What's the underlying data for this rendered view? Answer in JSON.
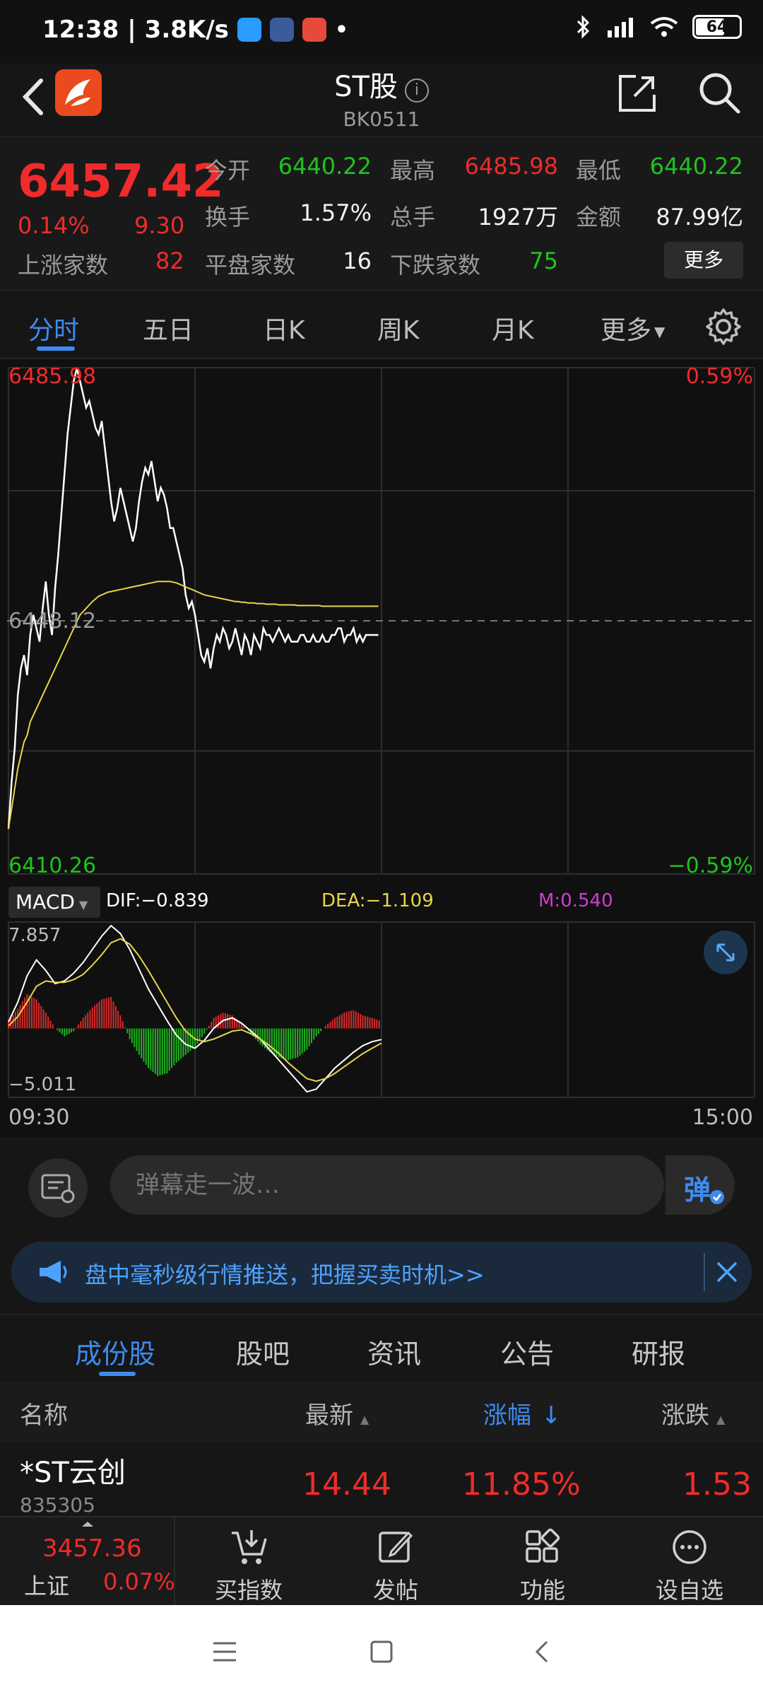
{
  "status_bar": {
    "time": "12:38",
    "net_speed": "3.8K/s",
    "battery": "64"
  },
  "header": {
    "title": "ST股",
    "code": "BK0511"
  },
  "quote": {
    "price": "6457.42",
    "pct": "0.14%",
    "change": "9.30",
    "up_count_label": "上涨家数",
    "up_count": "82",
    "open_label": "今开",
    "open": "6440.22",
    "high_label": "最高",
    "high": "6485.98",
    "low_label": "最低",
    "low": "6440.22",
    "turnover_label": "换手",
    "turnover": "1.57%",
    "volume_label": "总手",
    "volume": "1927万",
    "amount_label": "金额",
    "amount": "87.99亿",
    "flat_label": "平盘家数",
    "flat_count": "16",
    "down_label": "下跌家数",
    "down_count": "75",
    "more": "更多"
  },
  "ktabs": [
    "分时",
    "五日",
    "日K",
    "周K",
    "月K",
    "更多"
  ],
  "chart_data": {
    "type": "line",
    "y_top": "6485.98",
    "y_mid": "6448.12",
    "y_bottom": "6410.26",
    "pct_top": "0.59%",
    "pct_bottom": "−0.59%",
    "ylim": [
      6410.26,
      6485.98
    ],
    "x_start": "09:30",
    "x_end": "15:00",
    "total_minutes": 240,
    "series": [
      {
        "values": [
          6417,
          6424,
          6429,
          6437,
          6441,
          6443,
          6440,
          6446,
          6449,
          6447,
          6445,
          6450,
          6454,
          6449,
          6446,
          6453,
          6458,
          6464,
          6470,
          6476,
          6480,
          6484,
          6485.9,
          6484,
          6482,
          6480,
          6481,
          6479,
          6477,
          6476,
          6478,
          6474,
          6470,
          6466,
          6463,
          6465,
          6468,
          6466,
          6464,
          6462,
          6460,
          6462,
          6466,
          6469,
          6471,
          6470,
          6472,
          6469,
          6466,
          6468,
          6467,
          6465,
          6462,
          6462,
          6460,
          6458,
          6456,
          6452,
          6450,
          6451,
          6449,
          6446,
          6443,
          6442,
          6444,
          6441,
          6444,
          6446,
          6445,
          6447,
          6446,
          6444,
          6445,
          6447,
          6445,
          6443,
          6446,
          6445,
          6443,
          6446,
          6445,
          6444,
          6447,
          6446,
          6446,
          6445,
          6446,
          6447,
          6446,
          6445,
          6446,
          6445,
          6445,
          6445,
          6446,
          6446,
          6445,
          6445,
          6446,
          6445,
          6445,
          6446,
          6445,
          6445,
          6446,
          6446,
          6447,
          6447,
          6445,
          6446,
          6446,
          6447,
          6445,
          6446,
          6445,
          6446,
          6446,
          6446,
          6446,
          6446
        ],
        "color": "#ffffff"
      },
      {
        "values": [
          6417,
          6420,
          6423,
          6426,
          6428,
          6430,
          6431,
          6433,
          6434,
          6435,
          6436,
          6437,
          6438,
          6439,
          6440,
          6441,
          6442,
          6443,
          6444,
          6445,
          6446,
          6447,
          6448,
          6449,
          6449.5,
          6450,
          6450.5,
          6451,
          6451.4,
          6451.8,
          6452,
          6452.2,
          6452.4,
          6452.5,
          6452.6,
          6452.7,
          6452.8,
          6452.9,
          6453,
          6453.1,
          6453.2,
          6453.3,
          6453.4,
          6453.5,
          6453.6,
          6453.7,
          6453.8,
          6453.9,
          6454,
          6454,
          6454,
          6454,
          6454,
          6453.9,
          6453.8,
          6453.6,
          6453.4,
          6453.2,
          6453,
          6452.8,
          6452.6,
          6452.4,
          6452.2,
          6452,
          6451.9,
          6451.8,
          6451.7,
          6451.6,
          6451.5,
          6451.4,
          6451.3,
          6451.2,
          6451.1,
          6451,
          6451,
          6450.9,
          6450.9,
          6450.8,
          6450.8,
          6450.8,
          6450.7,
          6450.7,
          6450.7,
          6450.6,
          6450.6,
          6450.6,
          6450.6,
          6450.5,
          6450.5,
          6450.5,
          6450.5,
          6450.5,
          6450.5,
          6450.4,
          6450.4,
          6450.4,
          6450.4,
          6450.4,
          6450.4,
          6450.4,
          6450.4,
          6450.3,
          6450.3,
          6450.3,
          6450.3,
          6450.3,
          6450.3,
          6450.3,
          6450.3,
          6450.3,
          6450.3,
          6450.3,
          6450.3,
          6450.3,
          6450.3,
          6450.3,
          6450.3,
          6450.3,
          6450.3,
          6450.3
        ],
        "color": "#e8d44a"
      }
    ]
  },
  "macd": {
    "label": "MACD",
    "dif": "DIF:−0.839",
    "dea": "DEA:−1.109",
    "m": "M:0.540",
    "y_top": "7.857",
    "y_bottom": "−5.011",
    "ylim": [
      -5.011,
      7.857
    ],
    "dif_values": [
      0.5,
      2,
      4,
      5.2,
      4.4,
      3.4,
      3.6,
      4.2,
      5,
      6,
      7,
      7.8,
      7.2,
      6,
      4.5,
      3,
      1.8,
      0.6,
      -0.5,
      -1.2,
      -1.5,
      -0.9,
      0,
      0.6,
      0.8,
      0.4,
      -0.2,
      -0.8,
      -1.6,
      -2.4,
      -3.2,
      -4,
      -4.8,
      -4.6,
      -3.8,
      -3,
      -2.4,
      -1.8,
      -1.3,
      -1.0,
      -0.84
    ],
    "dea_values": [
      0.2,
      0.9,
      2,
      3.2,
      3.6,
      3.5,
      3.5,
      3.7,
      4.1,
      4.8,
      5.6,
      6.5,
      6.8,
      6.4,
      5.5,
      4.4,
      3.2,
      2,
      0.8,
      -0.2,
      -0.8,
      -1,
      -0.8,
      -0.5,
      -0.2,
      -0.1,
      -0.4,
      -0.8,
      -1.3,
      -1.9,
      -2.6,
      -3.2,
      -3.8,
      -4,
      -3.8,
      -3.4,
      -2.9,
      -2.4,
      -1.9,
      -1.5,
      -1.109
    ],
    "hist_values": [
      0.6,
      1.5,
      2.6,
      2.2,
      1.2,
      0,
      -0.6,
      -0.2,
      0.8,
      1.6,
      2.2,
      2.4,
      1,
      -0.8,
      -2,
      -3,
      -3.6,
      -3.4,
      -2.6,
      -2,
      -1.4,
      -0.4,
      0.8,
      1.2,
      1,
      0.4,
      -0.4,
      -1.2,
      -1.8,
      -2.2,
      -2.4,
      -2.2,
      -1.6,
      -0.6,
      0.2,
      0.8,
      1.2,
      1.4,
      1.0,
      0.8,
      0.54
    ]
  },
  "danmaku": {
    "placeholder": "弹幕走一波…",
    "toggle": "弹"
  },
  "promo": {
    "text": "盘中毫秒级行情推送，把握买卖时机>>"
  },
  "bottom_tabs": [
    "成份股",
    "股吧",
    "资讯",
    "公告",
    "研报"
  ],
  "table": {
    "headers": {
      "name": "名称",
      "latest": "最新",
      "pct": "涨幅",
      "change": "涨跌"
    },
    "rows": [
      {
        "name": "*ST云创",
        "code": "835305",
        "latest": "14.44",
        "pct": "11.85%",
        "change": "1.53"
      }
    ]
  },
  "bottom_nav": {
    "index_value": "3457.36",
    "index_name": "上证",
    "index_pct": "0.07%",
    "items": [
      "买指数",
      "发帖",
      "功能",
      "设自选"
    ]
  }
}
